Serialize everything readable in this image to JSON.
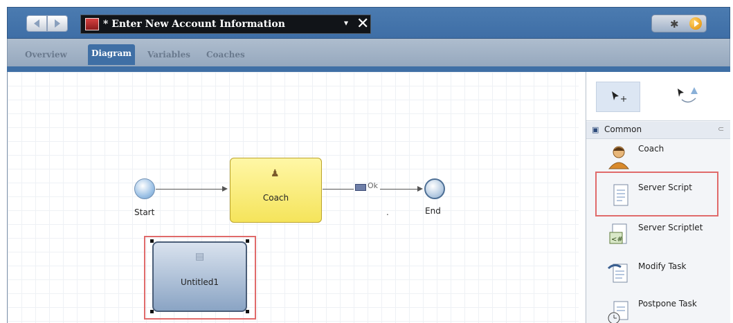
{
  "titlebar": {
    "process_title": "* Enter New Account Information",
    "dropdown_glyph": "▾",
    "close_glyph": "✕",
    "icons": [
      "back-icon",
      "forward-icon",
      "process-icon",
      "debug-icon",
      "run-icon"
    ]
  },
  "tabs": [
    {
      "label": "Overview",
      "active": false
    },
    {
      "label": "Diagram",
      "active": true
    },
    {
      "label": "Variables",
      "active": false
    },
    {
      "label": "Coaches",
      "active": false
    }
  ],
  "diagram": {
    "start_label": "Start",
    "coach_label": "Coach",
    "flow_label": "Ok",
    "end_label": "End",
    "dot": ".",
    "selected_node_label": "Untitled1"
  },
  "palette": {
    "section": "Common",
    "items": [
      {
        "label": "Coach",
        "icon": "person-icon"
      },
      {
        "label": "Server Script",
        "icon": "script-document-icon",
        "highlighted": true
      },
      {
        "label": "Server Scriptlet",
        "icon": "scriptlet-icon"
      },
      {
        "label": "Modify Task",
        "icon": "modify-task-icon"
      },
      {
        "label": "Postpone Task",
        "icon": "postpone-task-icon"
      }
    ]
  },
  "colors": {
    "titlebar": "#3e6ea6",
    "coach_fill": "#f5e45b",
    "selection": "#e06a6a"
  }
}
